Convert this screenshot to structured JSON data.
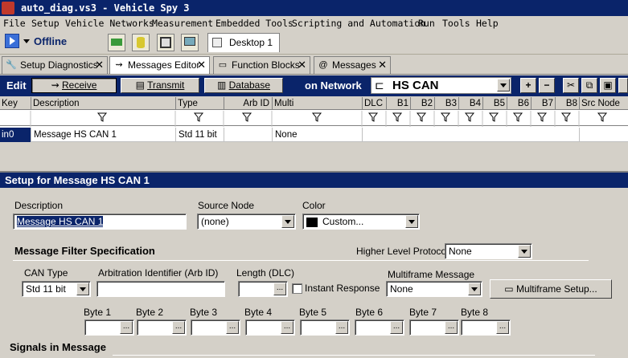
{
  "titlebar": {
    "title": "auto_diag.vs3 - Vehicle Spy 3"
  },
  "menu": [
    "File",
    "Setup",
    "Vehicle Networks",
    "Measurement",
    "Embedded Tools",
    "Scripting and Automation",
    "Run",
    "Tools",
    "Help"
  ],
  "toolbar": {
    "status": "Offline",
    "desktop_tab": "Desktop 1"
  },
  "tabs": [
    {
      "label": "Setup Diagnostics"
    },
    {
      "label": "Messages Editor"
    },
    {
      "label": "Function Blocks"
    },
    {
      "label": "Messages"
    }
  ],
  "editbar": {
    "edit_label": "Edit",
    "receive": "Receive",
    "transmit": "Transmit",
    "database": "Database",
    "on_network": "on Network",
    "network": "HS CAN"
  },
  "grid": {
    "headers": [
      "Key",
      "Description",
      "Type",
      "Arb ID",
      "Multi",
      "DLC",
      "B1",
      "B2",
      "B3",
      "B4",
      "B5",
      "B6",
      "B7",
      "B8",
      "Src Node"
    ],
    "row": {
      "key": "in0",
      "description": "Message HS CAN 1",
      "type": "Std 11 bit",
      "multi": "None"
    }
  },
  "setup": {
    "header": "Setup for Message HS CAN 1",
    "description_label": "Description",
    "description_value": "Message HS CAN 1",
    "source_node_label": "Source Node",
    "source_node_value": "(none)",
    "color_label": "Color",
    "color_value": "Custom...",
    "filter_spec": "Message Filter Specification",
    "higher_level_label": "Higher Level Protocol",
    "higher_level_value": "None",
    "can_type_label": "CAN Type",
    "can_type_value": "Std 11 bit",
    "arb_id_label": "Arbitration Identifier (Arb ID)",
    "length_label": "Length (DLC)",
    "instant_response": "Instant Response",
    "multiframe_label": "Multiframe Message",
    "multiframe_value": "None",
    "multiframe_setup": "Multiframe Setup...",
    "bytes": [
      "Byte 1",
      "Byte 2",
      "Byte 3",
      "Byte 4",
      "Byte 5",
      "Byte 6",
      "Byte 7",
      "Byte 8"
    ],
    "signals": "Signals in Message"
  }
}
